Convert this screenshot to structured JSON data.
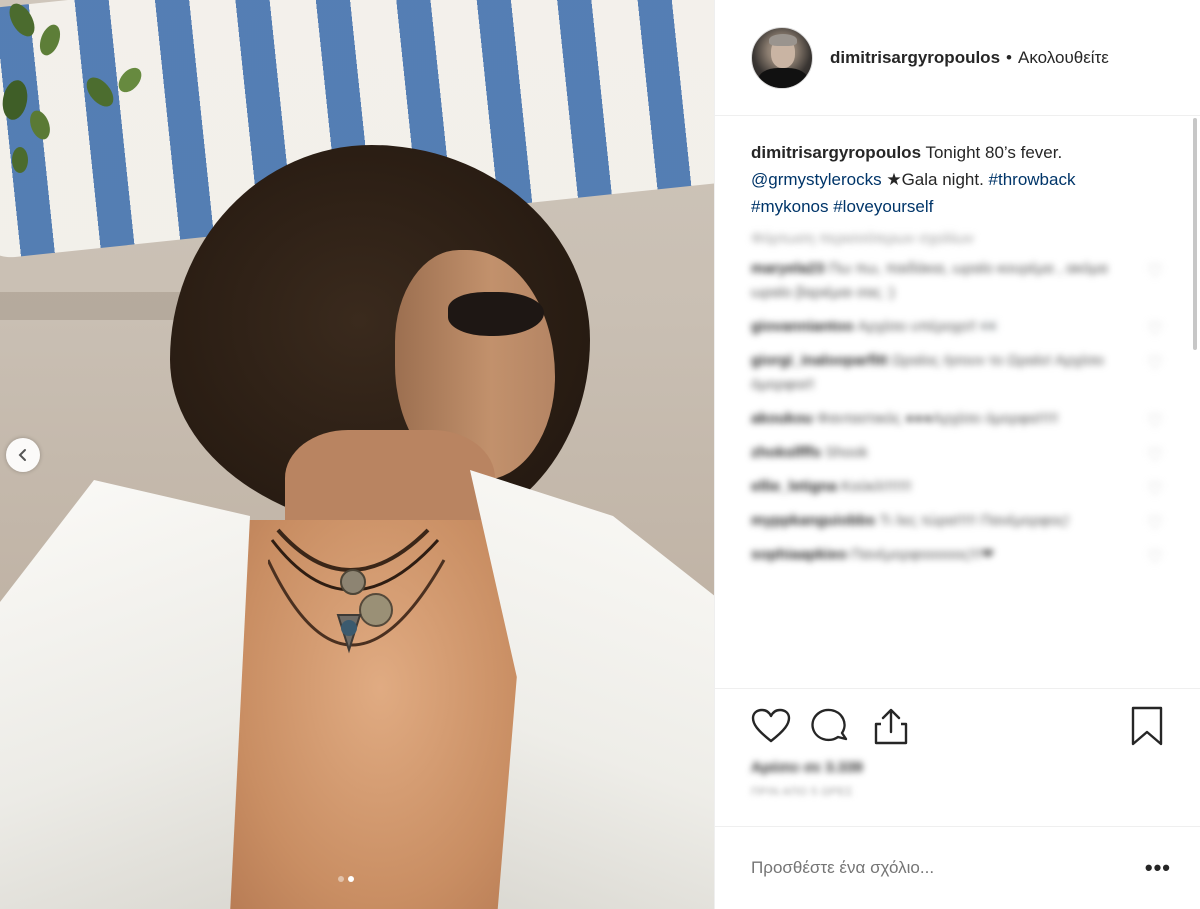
{
  "post": {
    "username": "dimitrisargyropoulos",
    "separator": "•",
    "follow_label": "Ακολουθείτε",
    "caption": {
      "username": "dimitrisargyropoulos",
      "text_1": " Tonight 80’s fever.",
      "mention": "@grmystylerocks",
      "emoji": " ★",
      "text_2": "Gala night. ",
      "tag_1": "#throwback",
      "tag_2": "#mykonos",
      "tag_3": "#loveyourself"
    },
    "load_more": "Φόρτωση περισσότερων σχολίων",
    "comments": [
      {
        "user": "maryela23",
        "text": "Πω πω, παιδάκια, ωραίο κουρέμα , ακόμα ωραίο βαριέμαι σας :)"
      },
      {
        "user": "giovanniantoo",
        "text": "Αρχίσει υπέροχο!! 👀"
      },
      {
        "user": "giorgi_inalooparfitt",
        "text": "Ωραίος ήσουν το Ωραίο! Αρχίσει όμορφοι!!"
      },
      {
        "user": "akoukou",
        "text": "Φανταστικός ●●●Αρχίσει όμορφα!!!!!"
      },
      {
        "user": "zhokslfffs",
        "text": "Shook"
      },
      {
        "user": "ellie_letigna",
        "text": "Κούκλ!!!!!!!"
      },
      {
        "user": "myppkanguiobbs",
        "text": "Τι λες τώρα!!!!! Πανέμορφος!"
      },
      {
        "user": "sophiaapkieo",
        "text": "Πανέμορφοοοοος!!!❤"
      }
    ],
    "likes": "Αρέσει σε 3.339",
    "timestamp": "ΠΡΙΝ ΑΠΟ 5 ΩΡΕΣ",
    "add_comment_placeholder": "Προσθέστε ένα σχόλιο...",
    "more_label": "•••",
    "icons": {
      "like": "heart-icon",
      "comment": "comment-bubble-icon",
      "share": "share-icon",
      "save": "bookmark-icon",
      "prev": "chevron-left-icon"
    },
    "carousel": {
      "total": 2,
      "active": 2
    }
  }
}
